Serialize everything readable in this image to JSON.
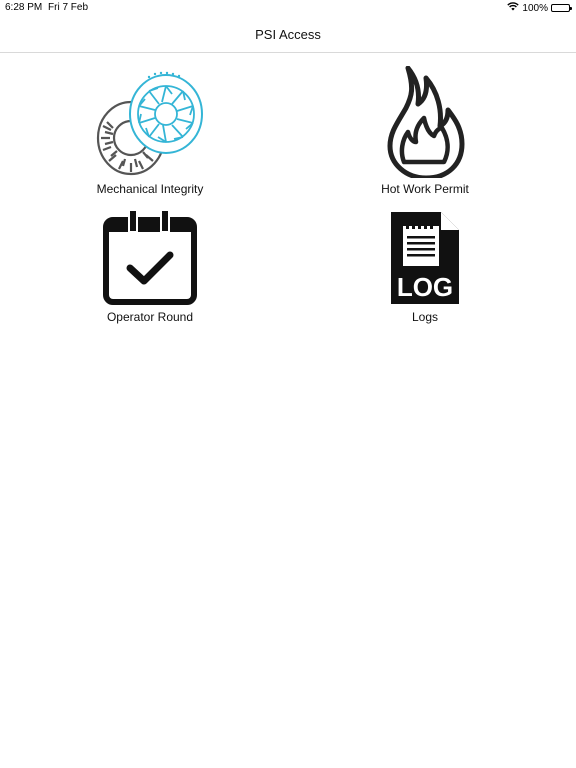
{
  "status_bar": {
    "time": "6:28 PM",
    "date": "Fri 7 Feb",
    "battery": "100%",
    "icons": [
      "wifi-icon",
      "battery-icon"
    ]
  },
  "nav": {
    "title": "PSI Access"
  },
  "tiles": [
    {
      "label": "Mechanical Integrity",
      "icon": "turbine-fan-icon"
    },
    {
      "label": "Hot Work Permit",
      "icon": "flame-icon"
    },
    {
      "label": "Operator Round",
      "icon": "calendar-check-icon"
    },
    {
      "label": "Logs",
      "icon": "log-file-icon"
    }
  ],
  "colors": {
    "accent_cyan": "#34b5d6",
    "icon_gray": "#555555",
    "icon_dark": "#222222"
  }
}
